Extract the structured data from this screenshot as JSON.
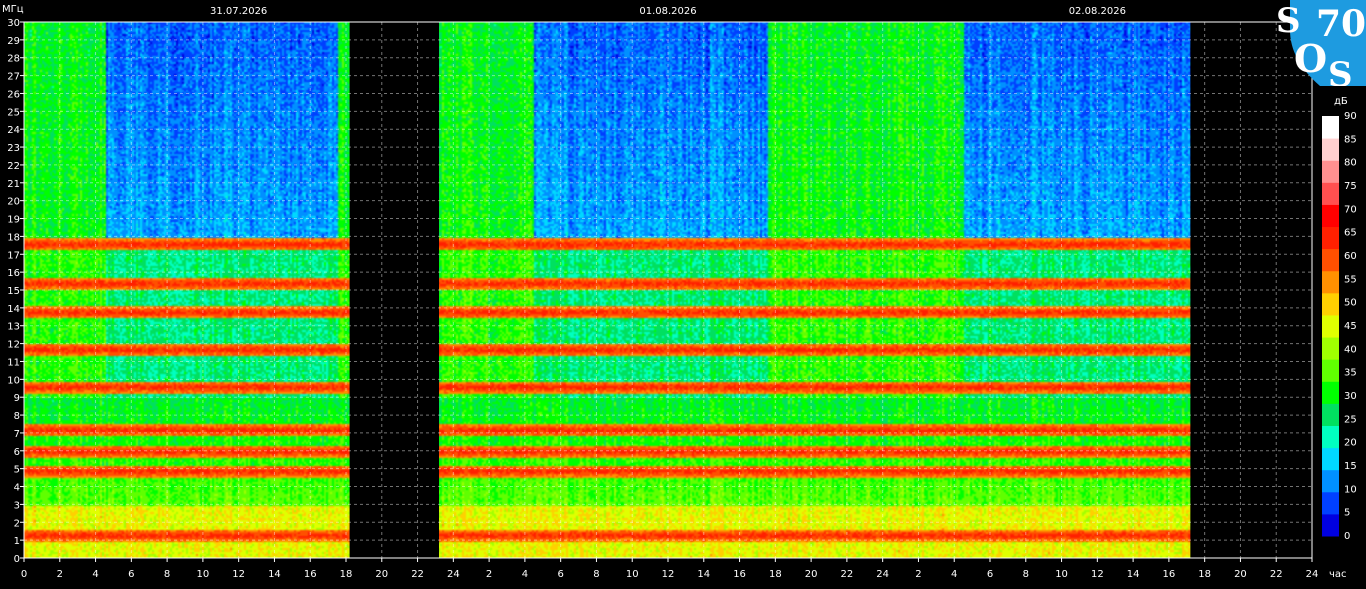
{
  "chart_data": {
    "type": "heatmap",
    "title": "",
    "ylabel": "МГц",
    "xlabel": "час",
    "colorbar_label": "дБ",
    "dates": [
      "31.07.2026",
      "01.08.2026",
      "02.08.2026"
    ],
    "x_ticks": [
      "0",
      "2",
      "4",
      "6",
      "8",
      "10",
      "12",
      "14",
      "16",
      "18",
      "20",
      "22",
      "24",
      "2",
      "4",
      "6",
      "8",
      "10",
      "12",
      "14",
      "16",
      "18",
      "20",
      "22",
      "24",
      "2",
      "4",
      "6",
      "8",
      "10",
      "12",
      "14",
      "16",
      "18",
      "20",
      "22",
      "24"
    ],
    "y_ticks": [
      "0",
      "1",
      "2",
      "3",
      "4",
      "5",
      "6",
      "7",
      "8",
      "9",
      "10",
      "11",
      "12",
      "13",
      "14",
      "15",
      "16",
      "17",
      "18",
      "19",
      "20",
      "21",
      "22",
      "23",
      "24",
      "25",
      "26",
      "27",
      "28",
      "29",
      "30"
    ],
    "ylim": [
      0,
      30
    ],
    "xlim_hours": [
      0,
      72
    ],
    "data_gaps_hours": [
      [
        18.2,
        23.2
      ],
      [
        65.2,
        72
      ]
    ],
    "bright_bands_mhz": [
      1.3,
      4.9,
      6.0,
      7.2,
      9.6,
      11.7,
      13.8,
      15.4,
      17.6
    ],
    "colorbar_ticks": [
      "0",
      "5",
      "10",
      "15",
      "20",
      "25",
      "30",
      "35",
      "40",
      "45",
      "50",
      "55",
      "60",
      "65",
      "70",
      "75",
      "80",
      "85",
      "90"
    ],
    "colorbar_colors": [
      "#0000e0",
      "#0040ff",
      "#0090ff",
      "#00d8ff",
      "#00ffc0",
      "#00e060",
      "#00ff00",
      "#60ff00",
      "#a0ff00",
      "#e0ff00",
      "#ffd000",
      "#ff9000",
      "#ff5000",
      "#ff2000",
      "#ff0000",
      "#ff5050",
      "#ff9090",
      "#ffd0d0",
      "#ffffff"
    ],
    "grid": true
  },
  "logo": {
    "letters": [
      "S",
      "70",
      "O",
      "S"
    ],
    "color": "#1e9be0"
  }
}
